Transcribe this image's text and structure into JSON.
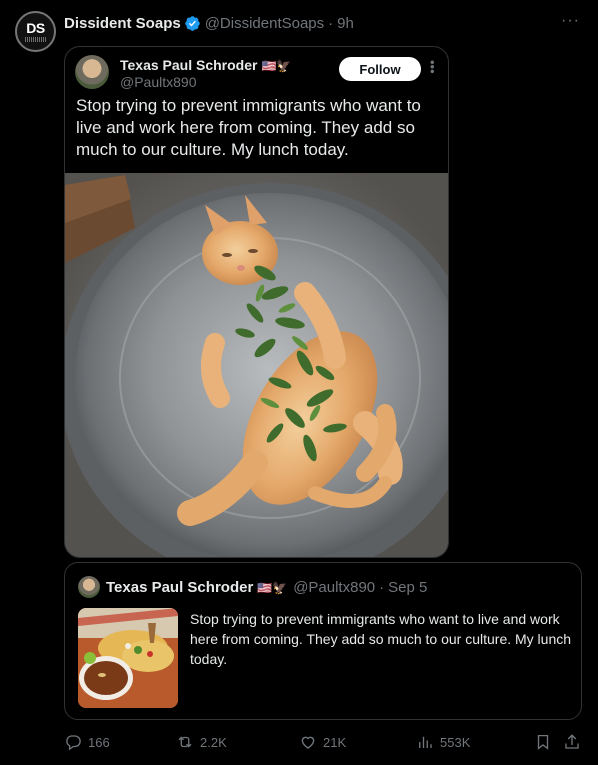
{
  "post": {
    "author_name": "Dissident Soaps",
    "author_handle": "@DissidentSoaps",
    "dot": "·",
    "time": "9h",
    "avatar_text": "DS",
    "more": "···"
  },
  "embedded": {
    "author_name": "Texas Paul Schroder",
    "flags": "🇺🇸🦅",
    "author_handle": "@Paultx890",
    "follow_label": "Follow",
    "text": "Stop trying to prevent immigrants who want to live and work here from coming.  They add so much to our culture.  My lunch today.",
    "media_alt": "photo"
  },
  "quote": {
    "author_name": "Texas Paul Schroder",
    "flags": "🇺🇸🦅",
    "author_handle": "@Paultx890",
    "dot": "·",
    "date": "Sep 5",
    "text": "Stop trying to prevent immigrants who want to live and work here from coming.  They add so much to our culture.  My lunch today."
  },
  "actions": {
    "replies": "166",
    "reposts": "2.2K",
    "likes": "21K",
    "views": "553K"
  },
  "colors": {
    "background": "#000000",
    "text": "#e7e9ea",
    "muted": "#71767b",
    "border": "#2f3336",
    "verified": "#1d9bf0"
  }
}
